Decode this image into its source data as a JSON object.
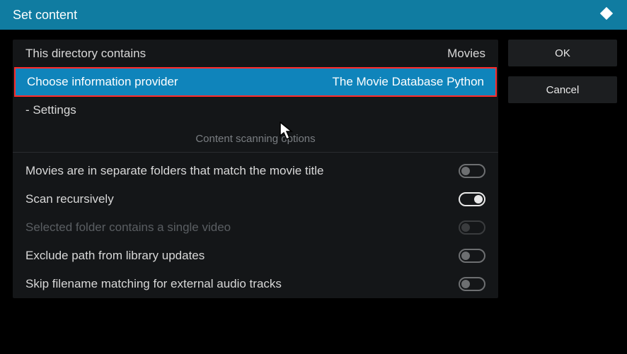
{
  "header": {
    "title": "Set content"
  },
  "main": {
    "directory_label": "This directory contains",
    "directory_value": "Movies",
    "provider_label": "Choose information provider",
    "provider_value": "The Movie Database Python",
    "settings_label": "- Settings",
    "section_title": "Content scanning options",
    "options": [
      {
        "label": "Movies are in separate folders that match the movie title",
        "state": "off",
        "disabled": false
      },
      {
        "label": "Scan recursively",
        "state": "on",
        "disabled": false
      },
      {
        "label": "Selected folder contains a single video",
        "state": "off",
        "disabled": true
      },
      {
        "label": "Exclude path from library updates",
        "state": "off",
        "disabled": false
      },
      {
        "label": "Skip filename matching for external audio tracks",
        "state": "off",
        "disabled": false
      }
    ]
  },
  "sidebar": {
    "ok_label": "OK",
    "cancel_label": "Cancel"
  }
}
